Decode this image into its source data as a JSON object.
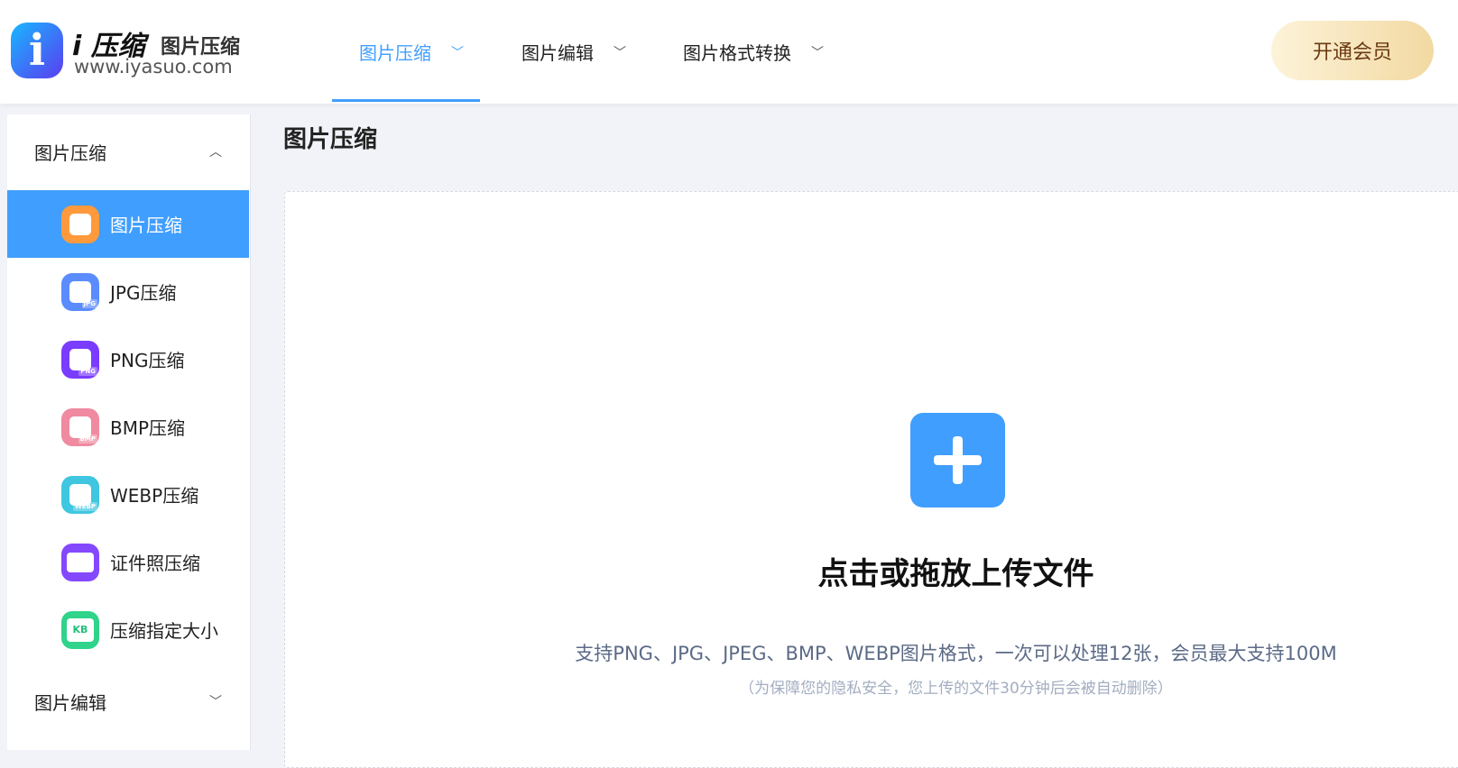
{
  "header": {
    "logo_letter": "i",
    "brand": "i 压缩",
    "brand_sub": "图片压缩",
    "domain": "www.iyasuo.com",
    "nav": [
      {
        "label": "图片压缩",
        "active": true
      },
      {
        "label": "图片编辑"
      },
      {
        "label": "图片格式转换"
      }
    ],
    "vip_label": "开通会员"
  },
  "sidebar": {
    "groups": [
      {
        "label": "图片压缩",
        "expanded": true
      },
      {
        "label": "图片编辑",
        "expanded": false
      }
    ],
    "items": [
      {
        "label": "图片压缩",
        "tag": "",
        "color": "#ff9a3c",
        "active": true
      },
      {
        "label": "JPG压缩",
        "tag": "JPG",
        "color": "#5b8cff"
      },
      {
        "label": "PNG压缩",
        "tag": "PNG",
        "color": "#7a3cff"
      },
      {
        "label": "BMP压缩",
        "tag": "BMP",
        "color": "#f08aa0"
      },
      {
        "label": "WEBP压缩",
        "tag": "WEBP",
        "color": "#3fc6e0"
      },
      {
        "label": "证件照压缩",
        "tag": "",
        "color": "#8448ff"
      },
      {
        "label": "压缩指定大小",
        "tag": "KB",
        "color": "#2fd38a"
      }
    ]
  },
  "main": {
    "title": "图片压缩",
    "upload_title": "点击或拖放上传文件",
    "upload_desc": "支持PNG、JPG、JPEG、BMP、WEBP图片格式，一次可以处理12张，会员最大支持100M",
    "upload_note": "（为保障您的隐私安全，您上传的文件30分钟后会被自动删除）"
  },
  "colors": {
    "accent": "#409eff",
    "vip_text": "#6b3a12"
  }
}
